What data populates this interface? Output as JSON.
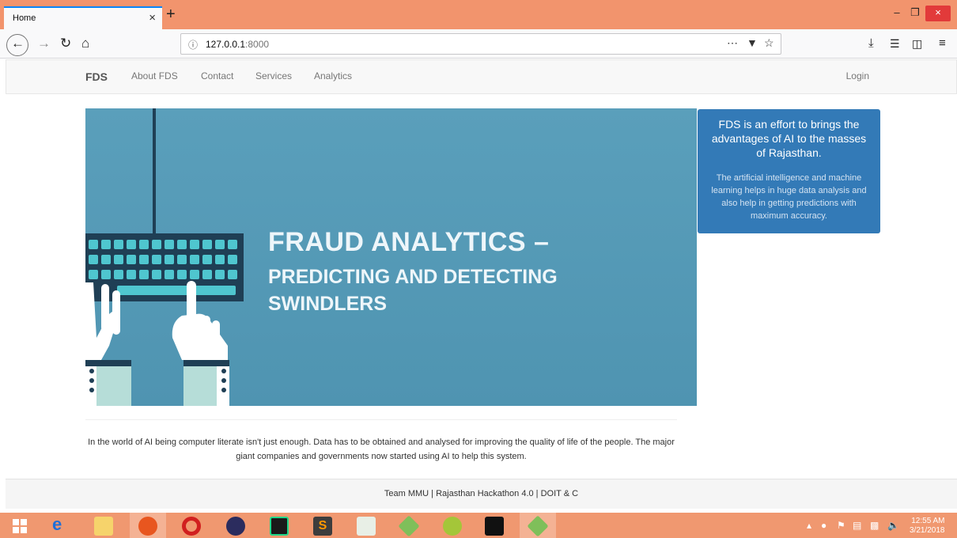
{
  "browser": {
    "tab_title": "Home",
    "tab_close": "×",
    "new_tab": "+",
    "url_host": "127.0.0.1",
    "url_port": ":8000",
    "window": {
      "minimize": "–",
      "maximize": "❐",
      "close": "×"
    }
  },
  "site": {
    "brand": "FDS",
    "menu": [
      "About FDS",
      "Contact",
      "Services",
      "Analytics"
    ],
    "login": "Login"
  },
  "hero": {
    "title_line1": "FRAUD ANALYTICS –",
    "title_line2": "PREDICTING AND DETECTING SWINDLERS"
  },
  "side_card": {
    "heading": "FDS is an effort to brings the advantages of AI to the masses of Rajasthan.",
    "body": "The artificial intelligence and machine learning helps in huge data analysis and also help in getting predictions with maximum accuracy."
  },
  "intro": "In the world of AI being computer literate isn't just enough. Data has to be obtained and analysed for improving the quality of life of the people. The major giant companies and governments now started using AI to help this system.",
  "footer": "Team MMU | Rajasthan Hackathon 4.0 | DOIT & C",
  "taskbar": {
    "time": "12:55 AM",
    "date": "3/21/2018"
  },
  "colors": {
    "tabbar": "#f2946d",
    "hero": "#5197b4",
    "side_card": "#337ab7",
    "keyboard_key": "#4fc6cf",
    "taskbar": "#f09870"
  }
}
